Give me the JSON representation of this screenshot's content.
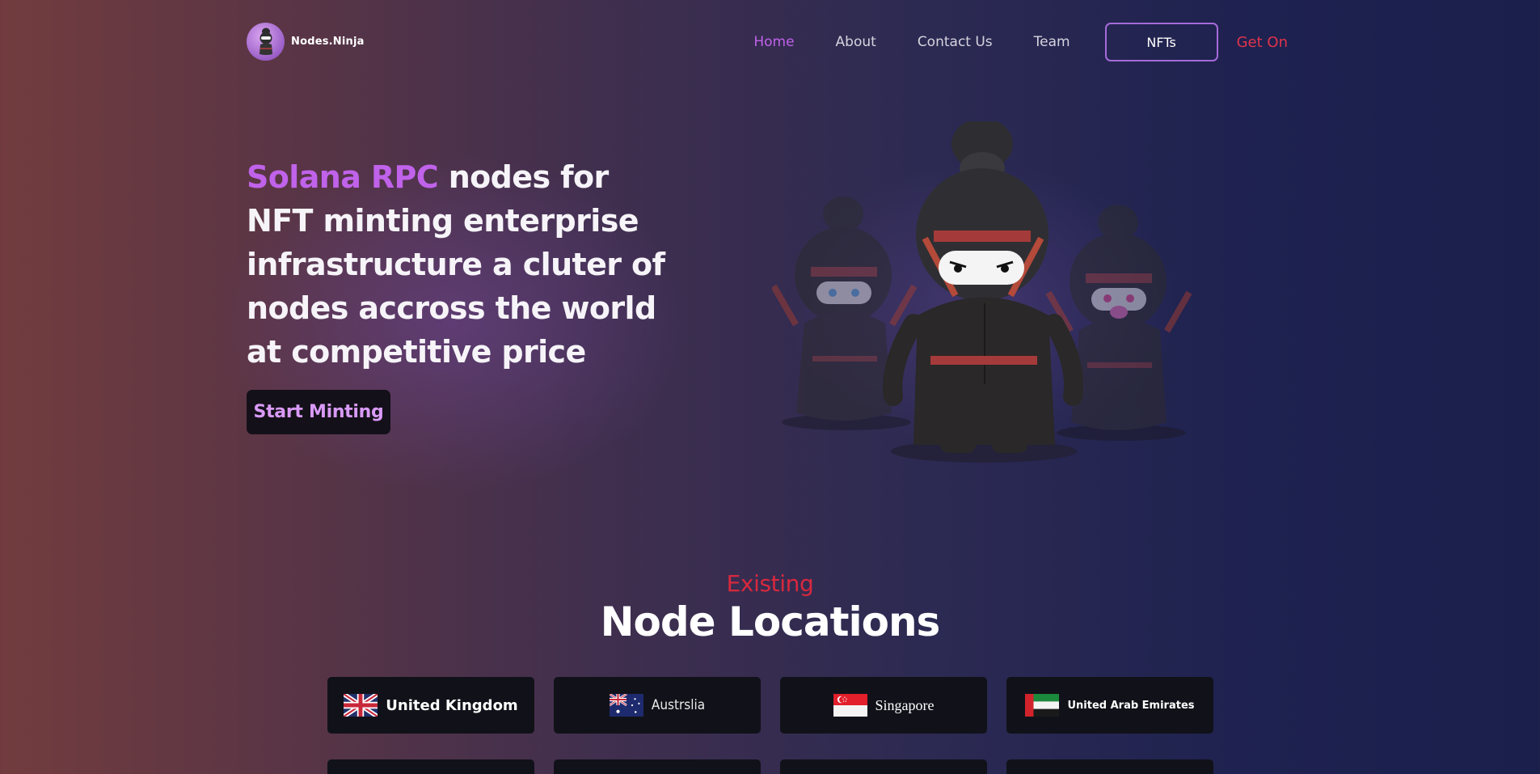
{
  "brand": {
    "name": "Nodes.Ninja"
  },
  "nav": {
    "items": [
      {
        "label": "Home",
        "active": true
      },
      {
        "label": "About",
        "active": false
      },
      {
        "label": "Contact Us",
        "active": false
      },
      {
        "label": "Team",
        "active": false
      }
    ],
    "button_label": "NFTs",
    "cta_label": "Get On"
  },
  "hero": {
    "accent_text": "Solana RPC",
    "text": " nodes for NFT minting enterprise infrastructure a cluter of nodes accross the world at competitive price",
    "cta_label": "Start Minting"
  },
  "locations": {
    "kicker": "Existing",
    "title": "Node Locations",
    "items": [
      {
        "name": "United Kingdom",
        "flag": "uk-flag-icon"
      },
      {
        "name": "Austrslia",
        "flag": "australia-flag-icon"
      },
      {
        "name": "Singapore",
        "flag": "singapore-flag-icon"
      },
      {
        "name": "United Arab Emirates",
        "flag": "uae-flag-icon"
      }
    ]
  },
  "colors": {
    "accent": "#c062ea",
    "red": "#d8283e",
    "card": "#111219"
  }
}
